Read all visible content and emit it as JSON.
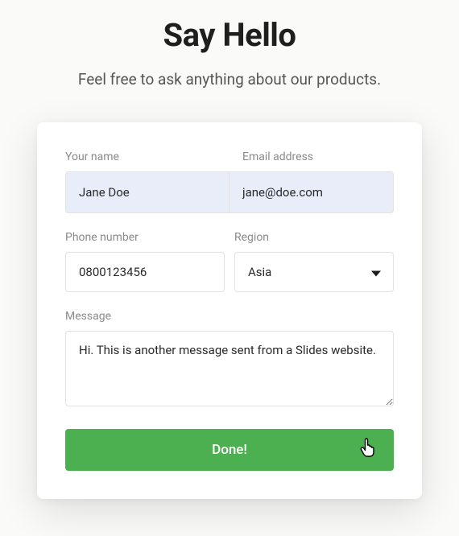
{
  "header": {
    "title": "Say Hello",
    "subtitle": "Feel free to ask anything about our products."
  },
  "form": {
    "name": {
      "label": "Your name",
      "value": "Jane Doe"
    },
    "email": {
      "label": "Email address",
      "value": "jane@doe.com"
    },
    "phone": {
      "label": "Phone number",
      "value": "0800123456"
    },
    "region": {
      "label": "Region",
      "selected": "Asia"
    },
    "message": {
      "label": "Message",
      "value": "Hi. This is another message sent from a Slides website."
    },
    "submit_label": "Done!"
  },
  "colors": {
    "accent": "#4caf50",
    "autofill": "#e8edf9"
  }
}
